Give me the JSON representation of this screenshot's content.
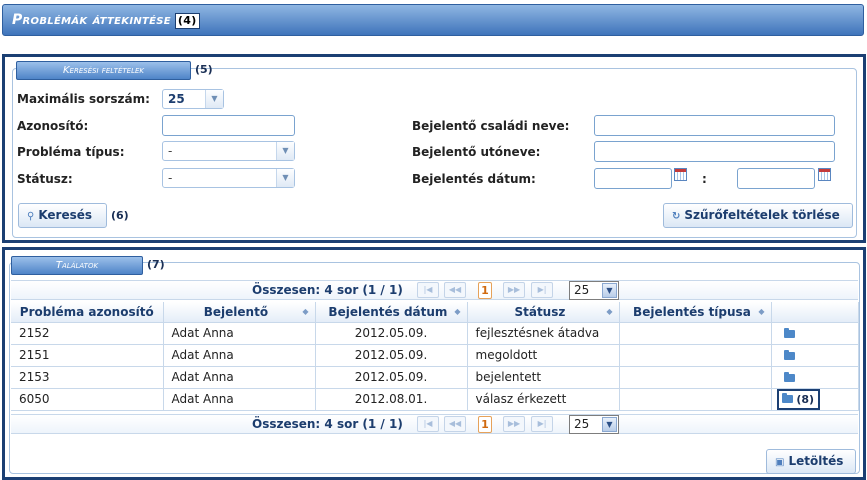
{
  "header": {
    "title": "Problémák áttekintése",
    "badge": "(4)"
  },
  "search": {
    "legend": "Keresési feltételek",
    "badge": "(5)",
    "max_label": "Maximális sorszám:",
    "max_value": "25",
    "id_label": "Azonosító:",
    "type_label": "Probléma típus:",
    "type_value": "-",
    "status_label": "Státusz:",
    "status_value": "-",
    "lastname_label": "Bejelentő családi neve:",
    "firstname_label": "Bejelentő utóneve:",
    "date_label": "Bejelentés dátum:",
    "date_sep": ":",
    "search_button": "Keresés",
    "search_badge": "(6)",
    "clear_button": "Szűrőfeltételek törlése"
  },
  "results": {
    "legend": "Találatok",
    "badge": "(7)",
    "pager_text": "Összesen: 4 sor (1 / 1)",
    "current_page": "1",
    "page_size": "25",
    "columns": [
      "Probléma azonosító",
      "Bejelentő",
      "Bejelentés dátum",
      "Státusz",
      "Bejelentés típusa",
      ""
    ],
    "rows": [
      {
        "id": "2152",
        "reporter": "Adat Anna",
        "date": "2012.05.09.",
        "status": "fejlesztésnek átadva",
        "type": ""
      },
      {
        "id": "2151",
        "reporter": "Adat Anna",
        "date": "2012.05.09.",
        "status": "megoldott",
        "type": ""
      },
      {
        "id": "2153",
        "reporter": "Adat Anna",
        "date": "2012.05.09.",
        "status": "bejelentett",
        "type": ""
      },
      {
        "id": "6050",
        "reporter": "Adat Anna",
        "date": "2012.08.01.",
        "status": "válasz érkezett",
        "type": ""
      }
    ],
    "row_badge": "(8)",
    "download_button": "Letöltés"
  }
}
